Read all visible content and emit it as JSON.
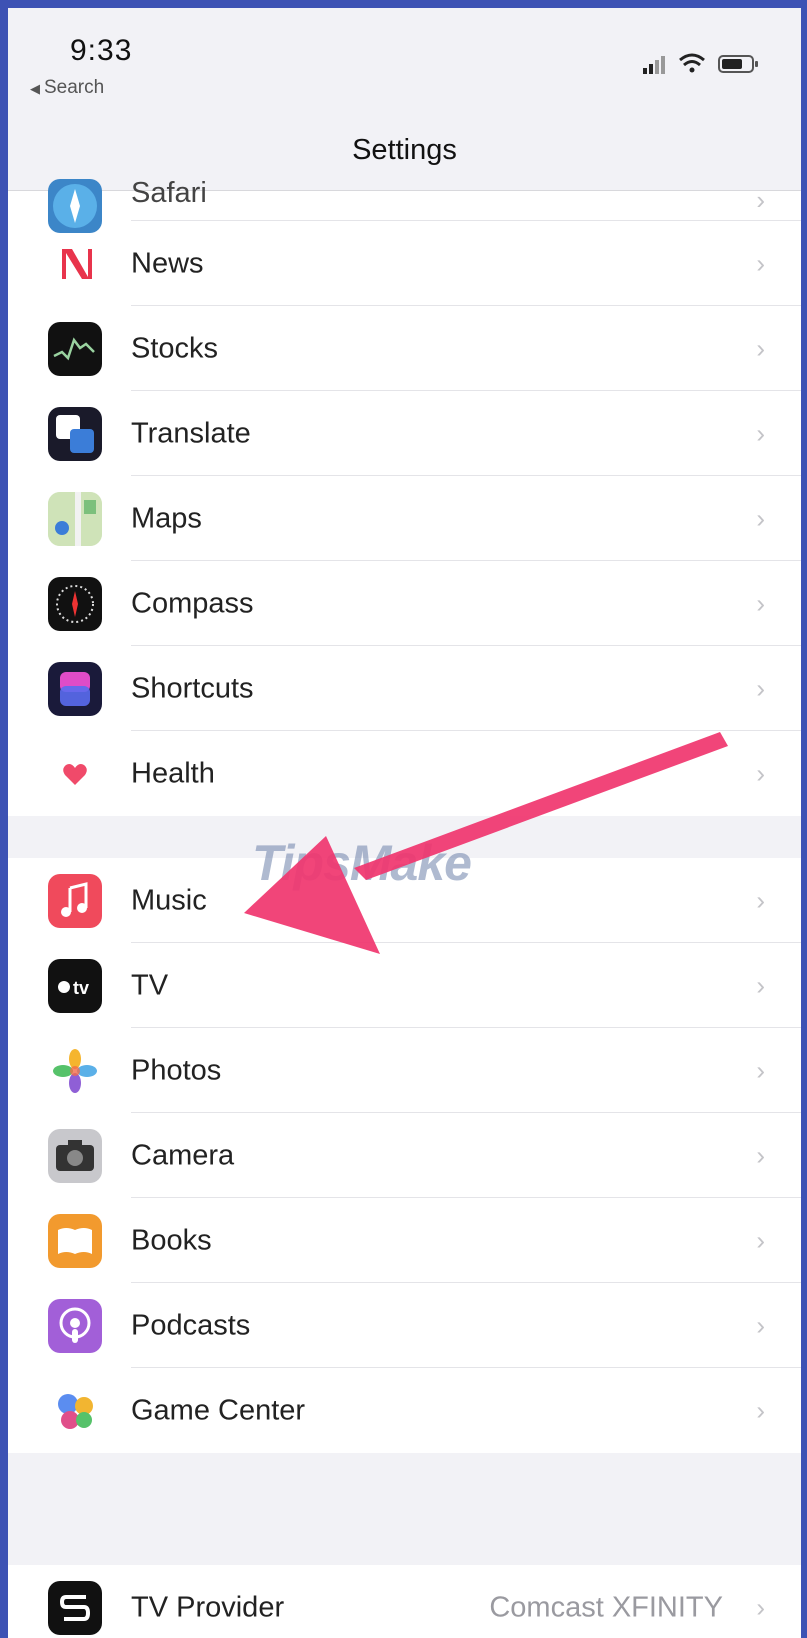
{
  "status_bar": {
    "time": "9:33",
    "back_label": "Search",
    "icons": [
      "signal-icon",
      "wifi-icon",
      "battery-icon"
    ]
  },
  "nav": {
    "title": "Settings"
  },
  "colors": {
    "outer_frame": "#3d52b4",
    "background": "#f2f2f6",
    "arrow": "#f0356e"
  },
  "group1": [
    {
      "label": "Safari",
      "icon": "safari-icon"
    },
    {
      "label": "News",
      "icon": "news-icon"
    },
    {
      "label": "Stocks",
      "icon": "stocks-icon"
    },
    {
      "label": "Translate",
      "icon": "translate-icon"
    },
    {
      "label": "Maps",
      "icon": "maps-icon"
    },
    {
      "label": "Compass",
      "icon": "compass-icon"
    },
    {
      "label": "Shortcuts",
      "icon": "shortcuts-icon"
    },
    {
      "label": "Health",
      "icon": "health-icon"
    }
  ],
  "group2": [
    {
      "label": "Music",
      "icon": "music-icon"
    },
    {
      "label": "TV",
      "icon": "tv-icon"
    },
    {
      "label": "Photos",
      "icon": "photos-icon"
    },
    {
      "label": "Camera",
      "icon": "camera-icon"
    },
    {
      "label": "Books",
      "icon": "books-icon"
    },
    {
      "label": "Podcasts",
      "icon": "podcasts-icon"
    },
    {
      "label": "Game Center",
      "icon": "game-center-icon"
    }
  ],
  "group3": [
    {
      "label": "TV Provider",
      "value": "Comcast XFINITY",
      "icon": "tv-provider-icon"
    }
  ],
  "watermark": "TipsMake"
}
